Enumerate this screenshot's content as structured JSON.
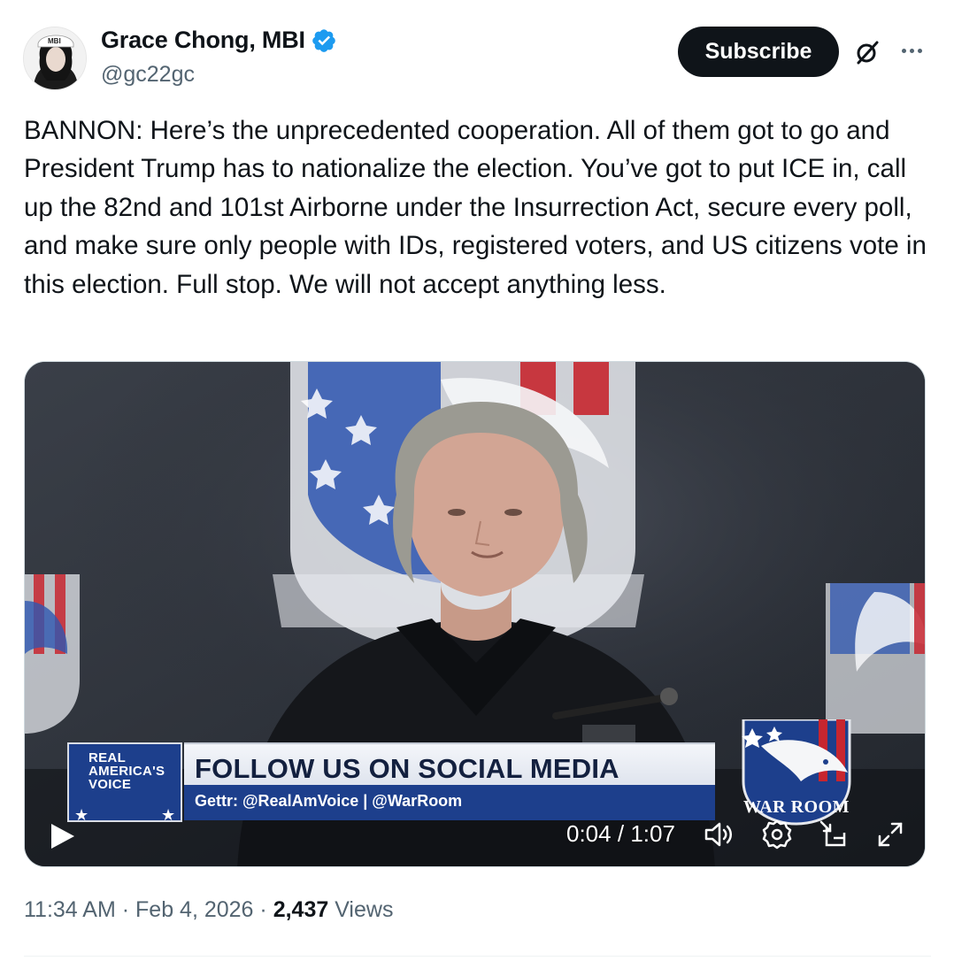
{
  "author": {
    "name": "Grace Chong, MBI",
    "handle": "@gc22gc",
    "avatar_cap_text": "MBI",
    "verified_color": "#1d9bf0"
  },
  "actions": {
    "subscribe_label": "Subscribe",
    "grok_icon": "grok-icon",
    "more_icon": "more-horizontal-icon"
  },
  "tweet": {
    "text": "BANNON: Here’s the unprecedented cooperation. All of them got to go and President Trump has to nationalize the election. You’ve got to put ICE in, call up the 82nd and 101st Airborne under the Insurrection Act, secure every poll, and make sure only people with IDs, registered voters, and US citizens vote in this election. Full stop. We will not accept anything less."
  },
  "video": {
    "lower_third": {
      "logo_text": "REAL ★☰ AMERICA'S VOICE",
      "logo_line1": "REAL",
      "logo_line2": "AMERICA'S",
      "logo_line3": "VOICE",
      "headline": "FOLLOW US ON SOCIAL MEDIA",
      "subline": "Gettr: @RealAmVoice | @WarRoom"
    },
    "badge_text": "WAR ROOM",
    "time_current": "0:04",
    "time_separator": "/",
    "time_total": "1:07",
    "time_display": "0:04 / 1:07",
    "icons": [
      "play-icon",
      "volume-icon",
      "settings-icon",
      "picture-in-picture-icon",
      "fullscreen-icon"
    ]
  },
  "meta": {
    "time": "11:34 AM",
    "date": "Feb 4, 2026",
    "separator": "·",
    "views_count": "2,437",
    "views_label": "Views"
  }
}
